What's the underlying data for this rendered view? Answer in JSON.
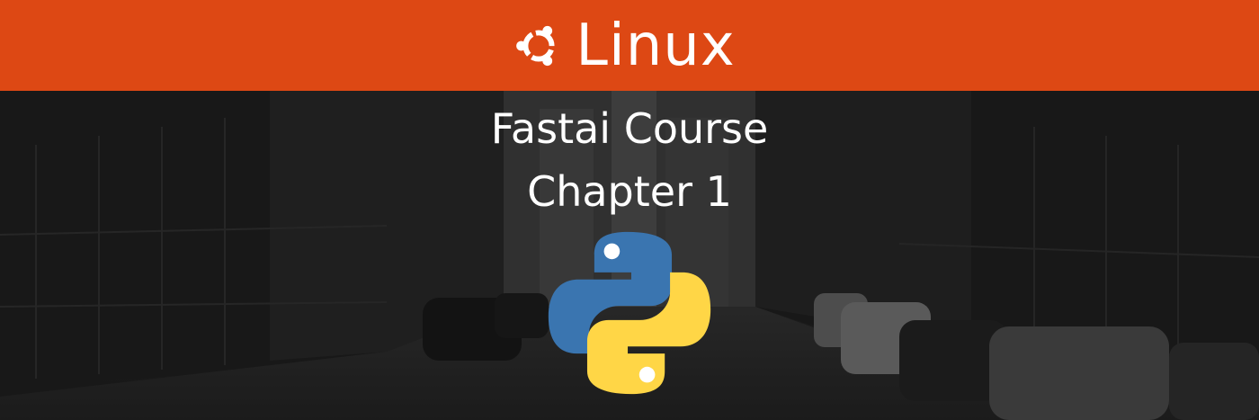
{
  "header": {
    "brand_name": "Linux",
    "brand_icon": "ubuntu-circle-of-friends-icon",
    "background_color": "#dd4814"
  },
  "title": {
    "line1": "Fastai Course",
    "line2": "Chapter 1"
  },
  "logo": {
    "icon": "python-logo-icon",
    "colors": {
      "blue": "#3a75b0",
      "yellow": "#ffd646"
    }
  },
  "background": {
    "description_icon": "city-street-photo"
  }
}
